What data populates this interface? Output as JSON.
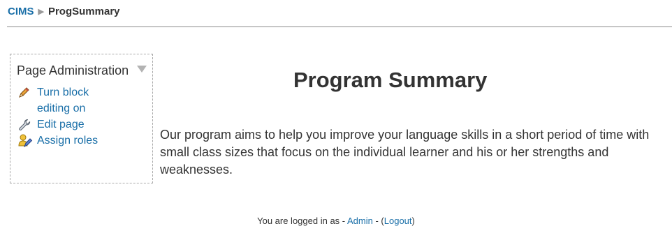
{
  "breadcrumb": {
    "home": "CIMS",
    "separator": "▶",
    "current": "ProgSummary"
  },
  "block": {
    "title": "Page Administration",
    "items": [
      {
        "label": "Turn block editing on",
        "icon": "pencil-icon"
      },
      {
        "label": "Edit page",
        "icon": "wrench-icon"
      },
      {
        "label": "Assign roles",
        "icon": "roles-icon"
      }
    ]
  },
  "main": {
    "title": "Program Summary",
    "text": "Our program aims to help you improve your language skills in a short period of time with small class sizes that focus on the individual learner and his or her strengths and weaknesses."
  },
  "footer": {
    "prefix": "You are logged in as - ",
    "user": "Admin",
    "middle": " - (",
    "logout": "Logout",
    "suffix": ")"
  },
  "colors": {
    "link": "#1a6fa8",
    "text": "#333333",
    "border": "#a9a9a9"
  }
}
